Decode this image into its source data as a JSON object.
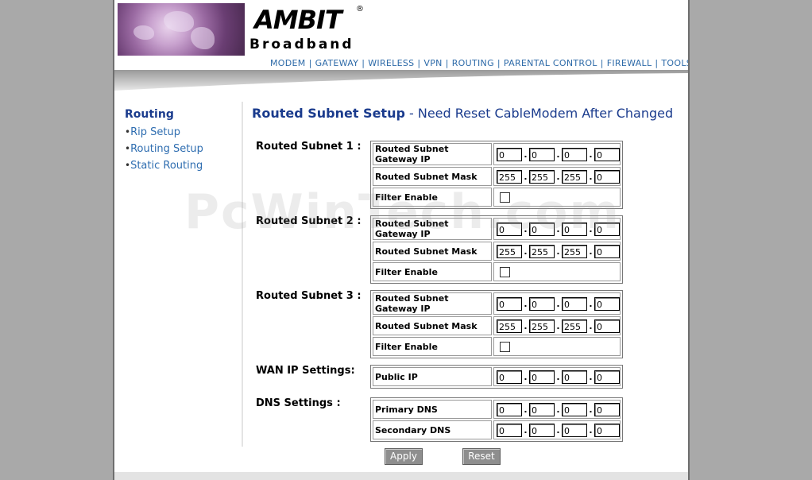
{
  "brand": {
    "name": "AMBIT",
    "registered": "®",
    "subtitle": "Broadband"
  },
  "top_nav": [
    "MODEM",
    "GATEWAY",
    "WIRELESS",
    "VPN",
    "ROUTING",
    "PARENTAL CONTROL",
    "FIREWALL",
    "TOOLS"
  ],
  "sidebar": {
    "title": "Routing",
    "items": [
      "Rip Setup",
      "Routing Setup",
      "Static Routing"
    ]
  },
  "page": {
    "title": "Routed Subnet Setup",
    "title_suffix": " - Need Reset CableModem After Changed"
  },
  "subnets": [
    {
      "label": "Routed Subnet 1 :",
      "gateway_label": "Routed Subnet Gateway IP",
      "gateway": [
        "0",
        "0",
        "0",
        "0"
      ],
      "mask_label": "Routed Subnet Mask",
      "mask": [
        "255",
        "255",
        "255",
        "0"
      ],
      "filter_label": "Filter Enable",
      "filter_enabled": false
    },
    {
      "label": "Routed Subnet 2 :",
      "gateway_label": "Routed Subnet Gateway IP",
      "gateway": [
        "0",
        "0",
        "0",
        "0"
      ],
      "mask_label": "Routed Subnet Mask",
      "mask": [
        "255",
        "255",
        "255",
        "0"
      ],
      "filter_label": "Filter Enable",
      "filter_enabled": false
    },
    {
      "label": "Routed Subnet 3 :",
      "gateway_label": "Routed Subnet Gateway IP",
      "gateway": [
        "0",
        "0",
        "0",
        "0"
      ],
      "mask_label": "Routed Subnet Mask",
      "mask": [
        "255",
        "255",
        "255",
        "0"
      ],
      "filter_label": "Filter Enable",
      "filter_enabled": false
    }
  ],
  "wan": {
    "label": "WAN IP Settings:",
    "public_ip_label": "Public IP",
    "public_ip": [
      "0",
      "0",
      "0",
      "0"
    ]
  },
  "dns": {
    "label": "DNS Settings :",
    "primary_label": "Primary DNS",
    "primary": [
      "0",
      "0",
      "0",
      "0"
    ],
    "secondary_label": "Secondary DNS",
    "secondary": [
      "0",
      "0",
      "0",
      "0"
    ]
  },
  "buttons": {
    "apply": "Apply",
    "reset": "Reset"
  },
  "watermark": "PcWinTech.com"
}
